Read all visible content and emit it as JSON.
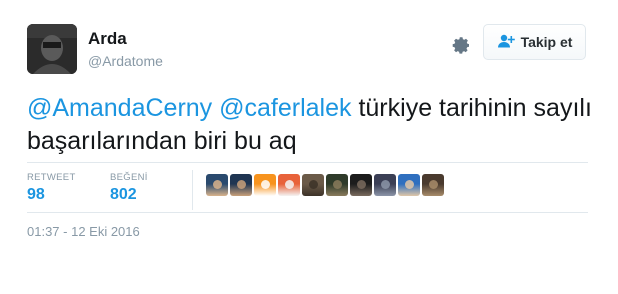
{
  "user": {
    "name": "Arda",
    "handle": "@Ardatome"
  },
  "follow_button": {
    "label": "Takip et"
  },
  "tweet": {
    "mention_1": "@AmandaCerny",
    "mention_2": "@caferlalek",
    "text": " türkiye tarihinin sayılı başarılarından biri bu aq"
  },
  "stats": {
    "retweets_label": "RETWEET",
    "retweets_value": "98",
    "likes_label": "BEĞENİ",
    "likes_value": "802"
  },
  "likers": [
    {
      "colors": [
        "#2a4a6e",
        "#d9b38c"
      ]
    },
    {
      "colors": [
        "#1f3552",
        "#c9a07a"
      ]
    },
    {
      "colors": [
        "#f7931e",
        "#ffffff"
      ]
    },
    {
      "colors": [
        "#e8623a",
        "#f4f4f4"
      ]
    },
    {
      "colors": [
        "#6b5a48",
        "#3c3228"
      ]
    },
    {
      "colors": [
        "#2f3b2a",
        "#8a7b5c"
      ]
    },
    {
      "colors": [
        "#1c1c1c",
        "#7a6b5e"
      ]
    },
    {
      "colors": [
        "#3b3f55",
        "#8c95a8"
      ]
    },
    {
      "colors": [
        "#2f6fbf",
        "#e0c7a8"
      ]
    },
    {
      "colors": [
        "#4a3a2e",
        "#a88c6a"
      ]
    }
  ],
  "timestamp": "01:37 - 12 Eki 2016",
  "colors": {
    "link": "#1b95e0",
    "muted": "#8899a6",
    "divider": "#e1e8ed"
  }
}
